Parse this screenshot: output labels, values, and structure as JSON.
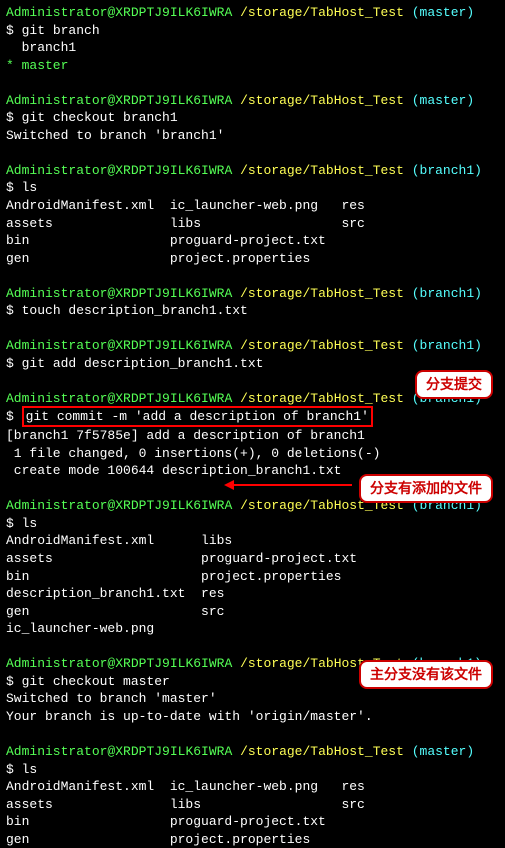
{
  "prompt": {
    "user": "Administrator",
    "host": "XRDPTJ9ILK6IWRA",
    "path": "/storage/TabHost_Test",
    "branch_master": "(master)",
    "branch_b1": "(branch1)",
    "dollar": "$"
  },
  "cmd": {
    "git_branch": "git branch",
    "git_checkout_b1": "git checkout branch1",
    "ls": "ls",
    "touch": "touch description_branch1.txt",
    "git_add": "git add description_branch1.txt",
    "git_commit": "git commit -m 'add a description of branch1'",
    "git_checkout_master": "git checkout master"
  },
  "out": {
    "branch1": "  branch1",
    "master_star": "* master",
    "switched_b1": "Switched to branch 'branch1'",
    "ls1_l1": "AndroidManifest.xml  ic_launcher-web.png   res",
    "ls1_l2": "assets               libs                  src",
    "ls1_l3": "bin                  proguard-project.txt",
    "ls1_l4": "gen                  project.properties",
    "commit_l1": "[branch1 7f5785e] add a description of branch1",
    "commit_l2": " 1 file changed, 0 insertions(+), 0 deletions(-)",
    "commit_l3": " create mode 100644 description_branch1.txt",
    "ls2_l1": "AndroidManifest.xml      libs",
    "ls2_l2": "assets                   proguard-project.txt",
    "ls2_l3": "bin                      project.properties",
    "ls2_l4": "description_branch1.txt  res",
    "ls2_l5": "gen                      src",
    "ls2_l6": "ic_launcher-web.png",
    "switched_master": "Switched to branch 'master'",
    "uptodate": "Your branch is up-to-date with 'origin/master'.",
    "ls3_l1": "AndroidManifest.xml  ic_launcher-web.png   res",
    "ls3_l2": "assets               libs                  src",
    "ls3_l3": "bin                  proguard-project.txt",
    "ls3_l4": "gen                  project.properties"
  },
  "callouts": {
    "c1": "分支提交",
    "c2": "分支有添加的文件",
    "c3": "主分支没有该文件"
  }
}
